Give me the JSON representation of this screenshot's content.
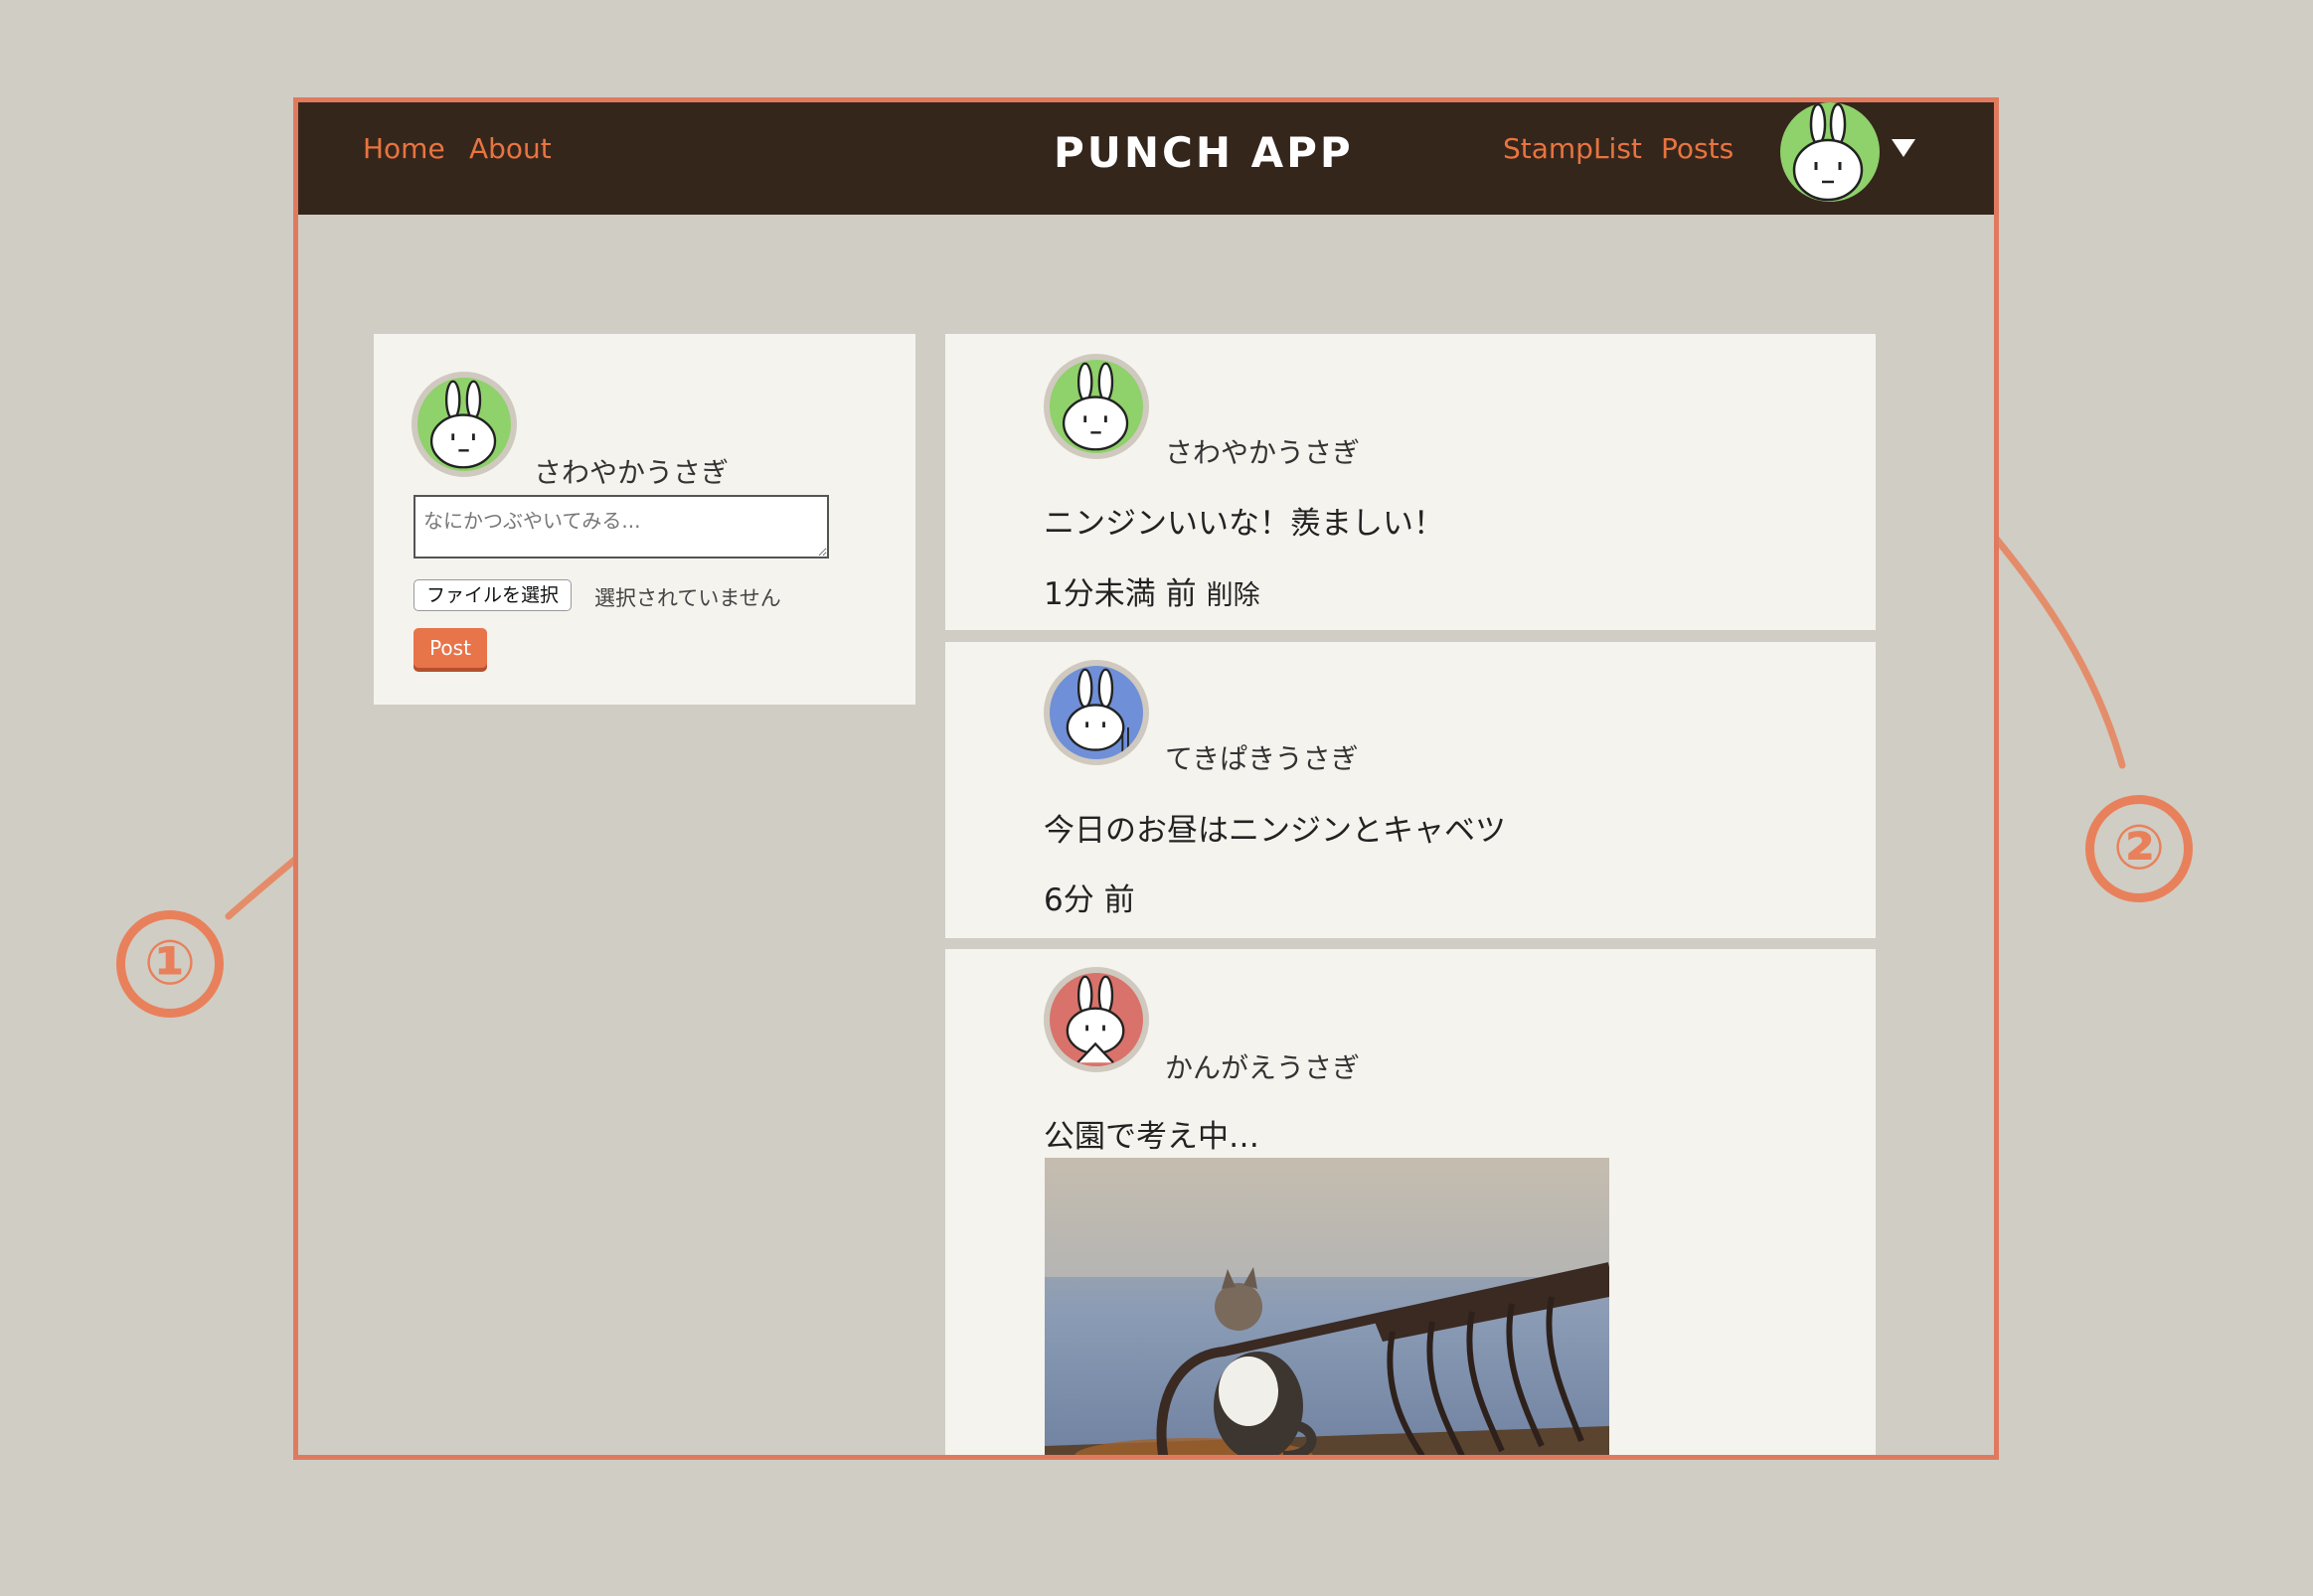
{
  "nav": {
    "home": "Home",
    "about": "About",
    "brand": "PUNCH APP",
    "stamplist": "StampList",
    "posts": "Posts"
  },
  "composer": {
    "username": "さわやかうさぎ",
    "placeholder": "なにかつぶやいてみる...",
    "file_button": "ファイルを選択",
    "file_status": "選択されていません",
    "post_button": "Post"
  },
  "feed": [
    {
      "username": "さわやかうさぎ",
      "text": "ニンジンいいな！羨ましい！",
      "time": "1分未満 前",
      "delete": "削除",
      "avatar_color": "#8fd16a"
    },
    {
      "username": "てきぱきうさぎ",
      "text": "今日のお昼はニンジンとキャベツ",
      "time": "6分 前",
      "avatar_color": "#6f8fd8"
    },
    {
      "username": "かんがえうさぎ",
      "text": "公園で考え中…",
      "avatar_color": "#d9726a"
    }
  ],
  "annotations": [
    "①",
    "②"
  ],
  "colors": {
    "navbar": "#35261c",
    "accent": "#e8743f",
    "frame": "#e07a5f"
  }
}
